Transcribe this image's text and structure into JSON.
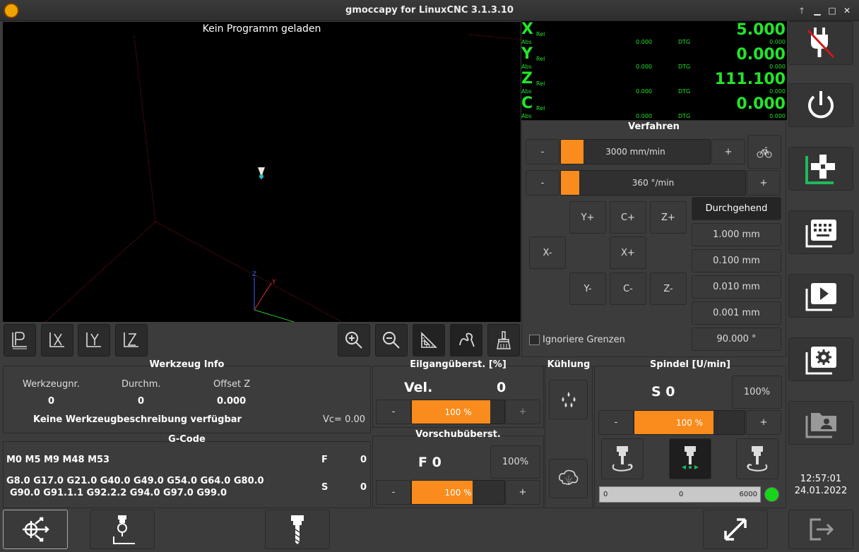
{
  "window": {
    "title": "gmoccapy for LinuxCNC  3.1.3.10"
  },
  "preview": {
    "message": "Kein Programm geladen"
  },
  "dro": {
    "rel_label": "Rel",
    "abs_label": "Abs",
    "dtg_label": "DTG",
    "axes": [
      {
        "letter": "X",
        "value": "5.000",
        "abs": "0.000",
        "dtg": "0.000"
      },
      {
        "letter": "Y",
        "value": "0.000",
        "abs": "0.000",
        "dtg": "0.000"
      },
      {
        "letter": "Z",
        "value": "111.100",
        "abs": "0.000",
        "dtg": "0.000"
      },
      {
        "letter": "C",
        "value": "0.000",
        "abs": "0.000",
        "dtg": "0.000"
      }
    ]
  },
  "jog": {
    "title": "Verfahren",
    "minus": "-",
    "plus": "+",
    "linear_velocity": "3000 mm/min",
    "linear_fraction": 0.15,
    "angular_velocity": "360 °/min",
    "angular_fraction": 0.1,
    "buttons": {
      "y_plus": "Y+",
      "c_plus": "C+",
      "z_plus": "Z+",
      "x_minus": "X-",
      "x_plus": "X+",
      "y_minus": "Y-",
      "c_minus": "C-",
      "z_minus": "Z-"
    },
    "increments": [
      "Durchgehend",
      "1.000 mm",
      "0.100 mm",
      "0.010 mm",
      "0.001 mm",
      "90.000 °"
    ],
    "ignore_limits": "Ignoriere Grenzen"
  },
  "tool_info": {
    "title": "Werkzeug Info",
    "col_number": "Werkzeugnr.",
    "col_diameter": "Durchm.",
    "col_offset": "Offset Z",
    "number": "0",
    "diameter": "0",
    "offset": "0.000",
    "description": "Keine Werkzeugbeschreibung verfügbar",
    "vc": "Vc= 0.00"
  },
  "gcode": {
    "title": "G-Code",
    "mcodes": "M0 M5 M9 M48 M53",
    "gcodes_line1": "G8.0 G17.0 G21.0 G40.0 G49.0 G54.0 G64.0 G80.0",
    "gcodes_line2": "G90.0 G91.1.1 G92.2.2 G94.0 G97.0 G99.0",
    "f_label": "F",
    "f_value": "0",
    "s_label": "S",
    "s_value": "0"
  },
  "rapid_override": {
    "title": "Eilgangüberst. [%]",
    "vel_label": "Vel.",
    "vel_value": "0",
    "minus": "-",
    "plus": "+",
    "value": "100 %",
    "fraction": 0.85
  },
  "feed_override": {
    "title": "Vorschubüberst.",
    "f_display": "F  0",
    "reset": "100%",
    "minus": "-",
    "plus": "+",
    "value": "100 %",
    "fraction": 0.66
  },
  "coolant": {
    "title": "Kühlung"
  },
  "spindle": {
    "title": "Spindel [U/min]",
    "s_display": "S 0",
    "reset": "100%",
    "minus": "-",
    "plus": "+",
    "value": "100 %",
    "fraction": 0.72,
    "scale_min": "0",
    "scale_current": "0",
    "scale_max": "6000",
    "status_color": "#18d518"
  },
  "clock": {
    "time": "12:57:01",
    "date": "24.01.2022"
  },
  "colors": {
    "accent": "#f98c1c",
    "dro": "#22e52a",
    "active_mode": "#1fb85c"
  }
}
